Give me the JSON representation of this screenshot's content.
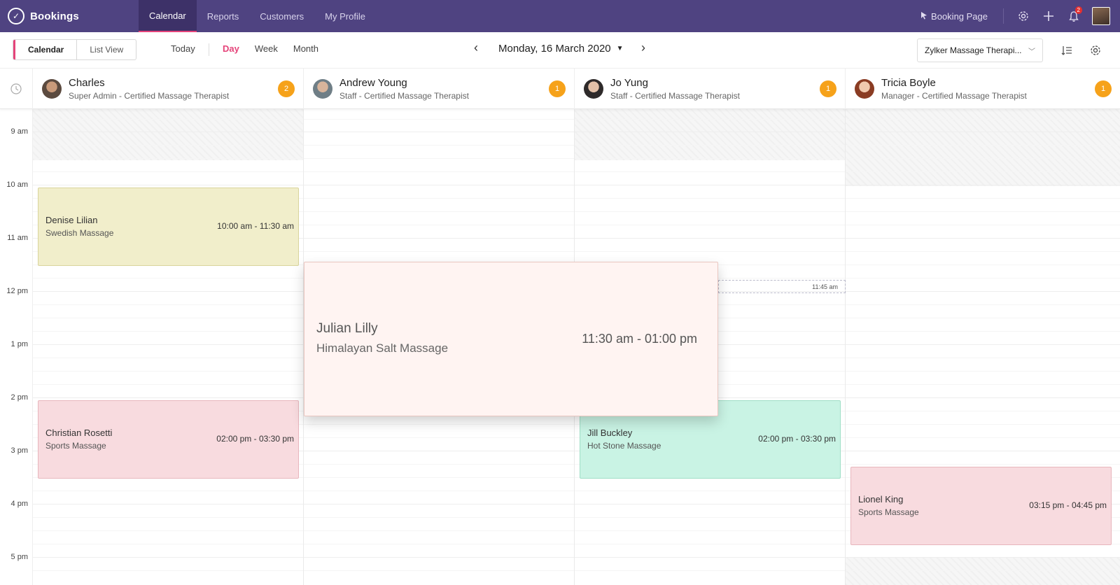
{
  "app": {
    "name": "Bookings"
  },
  "topnav": {
    "items": [
      {
        "label": "Calendar",
        "active": true
      },
      {
        "label": "Reports",
        "active": false
      },
      {
        "label": "Customers",
        "active": false
      },
      {
        "label": "My Profile",
        "active": false
      }
    ],
    "booking_page_label": "Booking Page",
    "notification_count": "2",
    "icons": [
      "settings-icon",
      "plus-icon",
      "bell-icon"
    ]
  },
  "toolbar": {
    "view_calendar": "Calendar",
    "view_list": "List View",
    "today": "Today",
    "ranges": [
      {
        "label": "Day",
        "active": true
      },
      {
        "label": "Week",
        "active": false
      },
      {
        "label": "Month",
        "active": false
      }
    ],
    "date_label": "Monday, 16 March 2020",
    "team_select": "Zylker Massage Therapi..."
  },
  "staff": [
    {
      "name": "Charles",
      "role": "Super Admin - Certified Massage Therapist",
      "count": "2"
    },
    {
      "name": "Andrew Young",
      "role": "Staff - Certified Massage Therapist",
      "count": "1"
    },
    {
      "name": "Jo Yung",
      "role": "Staff - Certified Massage Therapist",
      "count": "1"
    },
    {
      "name": "Tricia Boyle",
      "role": "Manager - Certified Massage Therapist",
      "count": "1"
    }
  ],
  "times": [
    "9 am",
    "10 am",
    "11 am",
    "12 pm",
    "1 pm",
    "2 pm",
    "3 pm",
    "4 pm",
    "5 pm"
  ],
  "appointments": [
    {
      "customer": "Denise Lilian",
      "service": "Swedish Massage",
      "time": "10:00 am - 11:30 am",
      "color": "#f1eecb",
      "border": "#d9d49c"
    },
    {
      "customer": "Christian Rosetti",
      "service": "Sports Massage",
      "time": "02:00 pm - 03:30 pm",
      "color": "#f8dbdf",
      "border": "#e8b6bd"
    },
    {
      "customer": "Jill Buckley",
      "service": "Hot Stone Massage",
      "time": "02:00 pm - 03:30 pm",
      "color": "#c9f3e4",
      "border": "#9fdec6"
    },
    {
      "customer": "Lionel King",
      "service": "Sports Massage",
      "time": "03:15 pm - 04:45 pm",
      "color": "#f8dbdf",
      "border": "#e8b6bd"
    }
  ],
  "drag_popup": {
    "customer": "Julian Lilly",
    "service": "Himalayan Salt Massage",
    "time": "11:30 am - 01:00 pm"
  },
  "drop_hint_time": "11:45 am",
  "colors": {
    "topbar": "#4f4381",
    "accent": "#e5447a",
    "count_badge": "#f6a21a"
  }
}
